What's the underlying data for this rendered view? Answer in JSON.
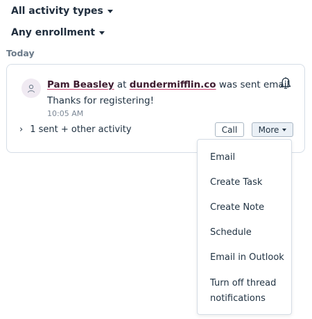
{
  "filters": {
    "activity_types": "All activity types",
    "enrollment": "Any enrollment"
  },
  "section": {
    "label": "Today"
  },
  "activity": {
    "contact_name": "Pam Beasley",
    "at_text": "at",
    "company": "dundermifflin.co",
    "action": "was sent email",
    "message": "Thanks for registering!",
    "time": "10:05 AM",
    "expand_label": "1 sent + other activity",
    "call_label": "Call",
    "more_label": "More"
  },
  "menu": {
    "items": [
      "Email",
      "Create Task",
      "Create Note",
      "Schedule",
      "Email in Outlook",
      "Turn off thread notifications"
    ]
  },
  "icons": {
    "avatar": "person-icon",
    "bell": "bell-icon",
    "expand": "chevron-right-icon",
    "dropdown": "caret-down-icon"
  },
  "colors": {
    "link_underline": "#c93c6c",
    "link_text": "#3d1a2e",
    "border": "#d5dde6"
  }
}
